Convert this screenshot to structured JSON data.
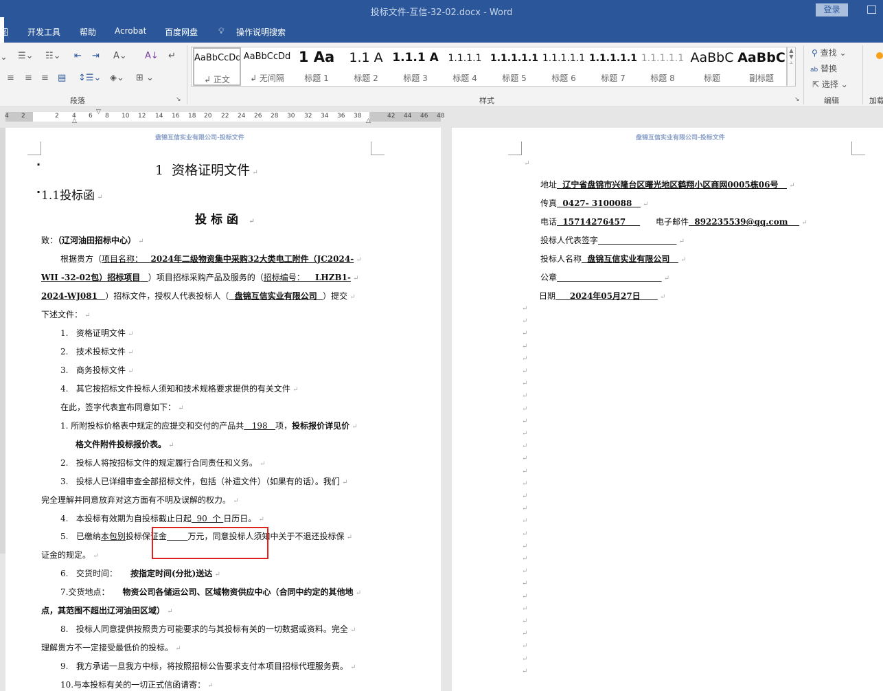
{
  "window": {
    "title": "投标文件-互信-32-02.docx  -  Word",
    "login": "登录"
  },
  "menu": [
    "图",
    "开发工具",
    "帮助",
    "Acrobat",
    "百度网盘",
    "操作说明搜索"
  ],
  "ribbon": {
    "groups": {
      "paragraph": "段落",
      "styles": "样式",
      "editing": "编辑",
      "addin": "加载"
    },
    "styles": [
      {
        "preview": "AaBbCcDd",
        "name": "↲ 正文"
      },
      {
        "preview": "AaBbCcDd",
        "name": "↲ 无间隔"
      },
      {
        "preview": "1  Aa",
        "name": "标题 1"
      },
      {
        "preview": "1.1  A",
        "name": "标题 2"
      },
      {
        "preview": "1.1.1  A",
        "name": "标题 3"
      },
      {
        "preview": "1.1.1.1",
        "name": "标题 4"
      },
      {
        "preview": "1.1.1.1.1",
        "name": "标题 5"
      },
      {
        "preview": "1.1.1.1.1",
        "name": "标题 6"
      },
      {
        "preview": "1.1.1.1.1",
        "name": "标题 7"
      },
      {
        "preview": "1.1.1.1.1",
        "name": "标题 8"
      },
      {
        "preview": "AaBbC",
        "name": "标题"
      },
      {
        "preview": "AaBbC",
        "name": "副标题"
      }
    ],
    "editing": {
      "find": "查找",
      "replace": "替换",
      "select": "选择"
    },
    "addin_label": "加载"
  },
  "ruler": [
    "4",
    "2",
    "2",
    "4",
    "6",
    "8",
    "10",
    "12",
    "14",
    "16",
    "18",
    "20",
    "22",
    "24",
    "26",
    "28",
    "30",
    "32",
    "34",
    "36",
    "38",
    "42",
    "44",
    "46",
    "48"
  ],
  "page1": {
    "header": "盘锦互信实业有限公司-投标文件",
    "lines": [
      {
        "cls": "h1",
        "segs": [
          {
            "t": "1  资格证明文件"
          }
        ]
      },
      {
        "cls": "h2",
        "segs": [
          {
            "t": "1.1投标函"
          }
        ]
      },
      {
        "cls": "h3",
        "segs": [
          {
            "t": "投标函"
          }
        ]
      },
      {
        "segs": [
          {
            "t": "致："
          },
          {
            "t": "（辽河油田招标中心）",
            "b": 1
          }
        ]
      },
      {
        "segs": [
          {
            "t": "根据贵方（"
          },
          {
            "t": "项目名称：   ",
            "u": 1
          },
          {
            "t": "2024年二级物资集中采购32大类电工附件（JC2024-",
            "u": 1,
            "b": 1
          }
        ]
      },
      {
        "segs": [
          {
            "t": "WII -32-02包）招标项目",
            "u": 1,
            "b": 1
          },
          {
            "t": "   ",
            "u": 1
          },
          {
            "t": "）项目招标采购产品及服务的（"
          },
          {
            "t": "招标编号：    ",
            "u": 1
          },
          {
            "t": "LHZB1-",
            "u": 1,
            "b": 1
          }
        ]
      },
      {
        "segs": [
          {
            "t": "2024-WJ081",
            "u": 1,
            "b": 1
          },
          {
            "t": "   ",
            "u": 1
          },
          {
            "t": "）招标文件，授权人代表投标人（"
          },
          {
            "t": "  盘锦互信实业有限公司  ",
            "u": 1,
            "b": 1
          },
          {
            "t": "）提交"
          }
        ]
      },
      {
        "segs": [
          {
            "t": "下述文件："
          }
        ]
      },
      {
        "segs": [
          {
            "t": "1.   资格证明文件"
          }
        ]
      },
      {
        "segs": [
          {
            "t": "2.   技术投标文件"
          }
        ]
      },
      {
        "segs": [
          {
            "t": "3.   商务投标文件"
          }
        ]
      },
      {
        "segs": [
          {
            "t": "4.   其它按招标文件投标人须知和技术规格要求提供的有关文件"
          }
        ]
      },
      {
        "segs": [
          {
            "t": "在此，签字代表宣布同意如下："
          }
        ]
      },
      {
        "segs": [
          {
            "t": "1. 所附投标价格表中规定的应提交和交付的产品共"
          },
          {
            "t": "   198   ",
            "u": 1
          },
          {
            "t": "项，"
          },
          {
            "t": "投标报价详见价",
            "b": 1
          }
        ]
      },
      {
        "segs": [
          {
            "t": "格文件附件投标报价表。",
            "b": 1
          }
        ]
      },
      {
        "segs": [
          {
            "t": "2.   投标人将按招标文件的规定履行合同责任和义务。"
          }
        ]
      },
      {
        "segs": [
          {
            "t": "3.   投标人已详细审查全部招标文件，包括（补遗文件）（如果有的话）。我们"
          }
        ]
      },
      {
        "segs": [
          {
            "t": "完全理解并同意放弃对这方面有不明及误解的权力。"
          }
        ]
      },
      {
        "segs": [
          {
            "t": "4.   本投标有效期为自投标截止日起"
          },
          {
            "t": "  90  个 ",
            "u": 1
          },
          {
            "t": "日历日。"
          }
        ]
      },
      {
        "segs": [
          {
            "t": "5.   已缴纳"
          },
          {
            "t": "本包别",
            "u": 1
          },
          {
            "t": "投标保证金"
          },
          {
            "t": "        ",
            "u": 1
          },
          {
            "t": "万元，同意投标人须知中关于不退还投标保"
          }
        ]
      },
      {
        "segs": [
          {
            "t": "证金的规定。"
          }
        ]
      },
      {
        "segs": [
          {
            "t": "6.   交货时间：     "
          },
          {
            "t": "按指定时间(分批)送达",
            "b": 1
          }
        ]
      },
      {
        "segs": [
          {
            "t": "7.交货地点：     "
          },
          {
            "t": "物资公司各储运公司、区域物资供应中心（合同中约定的其他地",
            "b": 1
          }
        ]
      },
      {
        "segs": [
          {
            "t": "点，其范围不超出辽河油田区域）",
            "b": 1
          }
        ]
      },
      {
        "segs": [
          {
            "t": "8.   投标人同意提供按照贵方可能要求的与其投标有关的一切数据或资料。完全"
          }
        ]
      },
      {
        "segs": [
          {
            "t": "理解贵方不一定接受最低价的投标。"
          }
        ]
      },
      {
        "segs": [
          {
            "t": "9.   我方承诺一旦我方中标，将按照招标公告要求支付本项目招标代理服务费。"
          }
        ]
      },
      {
        "segs": [
          {
            "t": "10.与本投标有关的一切正式信函请寄："
          }
        ]
      }
    ]
  },
  "page2": {
    "header": "盘锦互信实业有限公司-投标文件",
    "lines": [
      {
        "segs": [
          {
            "t": ""
          }
        ]
      },
      {
        "segs": [
          {
            "t": "地址"
          },
          {
            "t": "  辽宁省盘锦市兴隆台区曙光地区鹤翔小区商网0005栋06号   ",
            "u": 1,
            "b": 1
          }
        ]
      },
      {
        "segs": [
          {
            "t": "传真"
          },
          {
            "t": "  0427- 3100088   ",
            "u": 1,
            "b": 1
          }
        ]
      },
      {
        "segs": [
          {
            "t": "电话"
          },
          {
            "t": "  15714276457     ",
            "u": 1,
            "b": 1
          },
          {
            "t": "      电子邮件"
          },
          {
            "t": "  892235539@qq.com    ",
            "u": 1,
            "b": 1
          }
        ]
      },
      {
        "segs": [
          {
            "t": "投标人代表签字"
          },
          {
            "t": "                              ",
            "u": 1
          }
        ]
      },
      {
        "segs": [
          {
            "t": "投标人名称"
          },
          {
            "t": "  盘锦互信实业有限公司   ",
            "u": 1,
            "b": 1
          }
        ]
      },
      {
        "segs": [
          {
            "t": "公章"
          },
          {
            "t": "                                        ",
            "u": 1
          }
        ]
      },
      {
        "segs": [
          {
            "t": "日期"
          },
          {
            "t": "     2024年05月27日      ",
            "u": 1,
            "b": 1
          }
        ]
      }
    ]
  }
}
